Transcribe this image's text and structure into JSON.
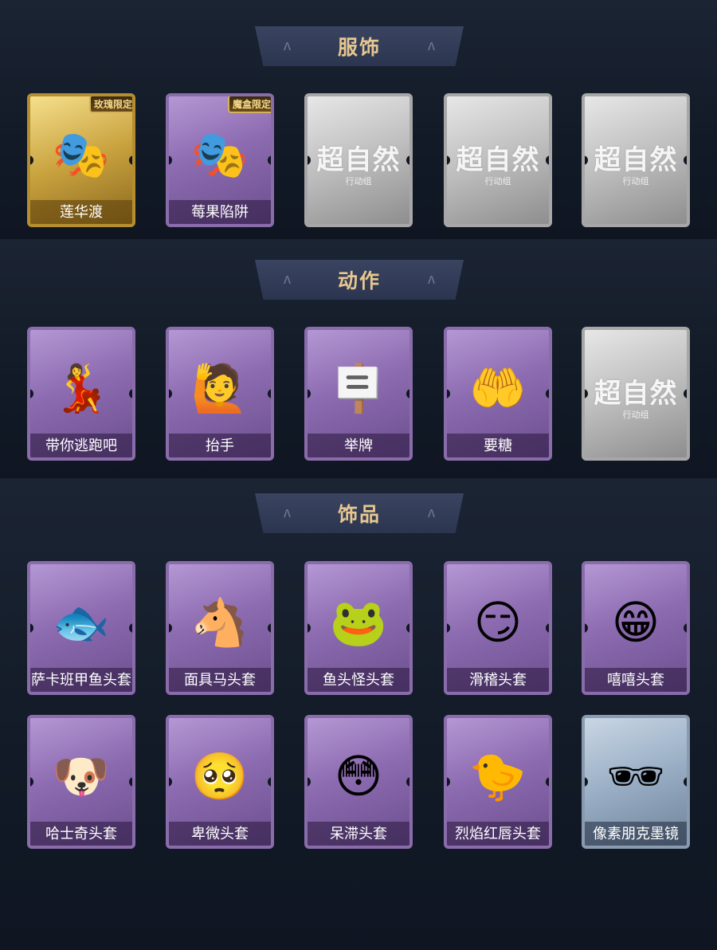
{
  "sections": [
    {
      "title": "服饰",
      "items": [
        {
          "label": "莲华渡",
          "style": "gold",
          "badge": "玫瑰限定",
          "icon": "costume-portrait-icon"
        },
        {
          "label": "莓果陷阱",
          "style": "purple",
          "badge": "魔盒限定",
          "icon": "costume-portrait-icon"
        },
        {
          "label": "",
          "style": "silver",
          "watermark": "超自然",
          "watermark_sub": "行动组",
          "icon": "placeholder-icon"
        },
        {
          "label": "",
          "style": "silver",
          "watermark": "超自然",
          "watermark_sub": "行动组",
          "icon": "placeholder-icon"
        },
        {
          "label": "",
          "style": "silver",
          "watermark": "超自然",
          "watermark_sub": "行动组",
          "icon": "placeholder-icon"
        }
      ]
    },
    {
      "title": "动作",
      "items": [
        {
          "label": "带你逃跑吧",
          "style": "purple",
          "icon": "dance-figure-icon"
        },
        {
          "label": "抬手",
          "style": "purple",
          "icon": "raise-hand-figure-icon"
        },
        {
          "label": "举牌",
          "style": "purple",
          "icon": "hold-sign-figure-icon"
        },
        {
          "label": "要糖",
          "style": "purple",
          "icon": "ask-candy-figure-icon"
        },
        {
          "label": "",
          "style": "silver",
          "watermark": "超自然",
          "watermark_sub": "行动组",
          "icon": "placeholder-icon"
        }
      ]
    },
    {
      "title": "饰品",
      "items": [
        {
          "label": "萨卡班甲鱼头套",
          "style": "purple",
          "icon": "fish-head-icon"
        },
        {
          "label": "面具马头套",
          "style": "purple",
          "icon": "horse-head-icon"
        },
        {
          "label": "鱼头怪头套",
          "style": "purple",
          "icon": "fish-monster-head-icon"
        },
        {
          "label": "滑稽头套",
          "style": "purple",
          "icon": "smirk-face-icon"
        },
        {
          "label": "嘻嘻头套",
          "style": "purple",
          "icon": "grin-face-icon"
        },
        {
          "label": "哈士奇头套",
          "style": "purple",
          "icon": "husky-head-icon"
        },
        {
          "label": "卑微头套",
          "style": "purple",
          "icon": "timid-face-icon"
        },
        {
          "label": "呆滞头套",
          "style": "purple",
          "icon": "dazed-face-icon"
        },
        {
          "label": "烈焰红唇头套",
          "style": "purple",
          "icon": "yellow-creature-head-icon"
        },
        {
          "label": "像素朋克墨镜",
          "style": "blue",
          "icon": "pixel-sunglasses-icon"
        }
      ]
    }
  ],
  "glyphs": {
    "costume-portrait-icon": "🎭",
    "placeholder-icon": "",
    "dance-figure-icon": "💃",
    "raise-hand-figure-icon": "🙋",
    "hold-sign-figure-icon": "🪧",
    "ask-candy-figure-icon": "🤲",
    "fish-head-icon": "🐟",
    "horse-head-icon": "🐴",
    "fish-monster-head-icon": "🐸",
    "smirk-face-icon": "😏",
    "grin-face-icon": "😁",
    "husky-head-icon": "🐶",
    "timid-face-icon": "🥺",
    "dazed-face-icon": "😳",
    "yellow-creature-head-icon": "🐤",
    "pixel-sunglasses-icon": "🕶"
  },
  "colors": {
    "background": "#0f1622",
    "banner": "#2c3550",
    "banner_text": "#e7c78f",
    "rarity_purple": "#8c6bb0",
    "rarity_gold": "#c9a23e",
    "rarity_silver": "#bdbdbd",
    "rarity_blue": "#98adc4"
  }
}
